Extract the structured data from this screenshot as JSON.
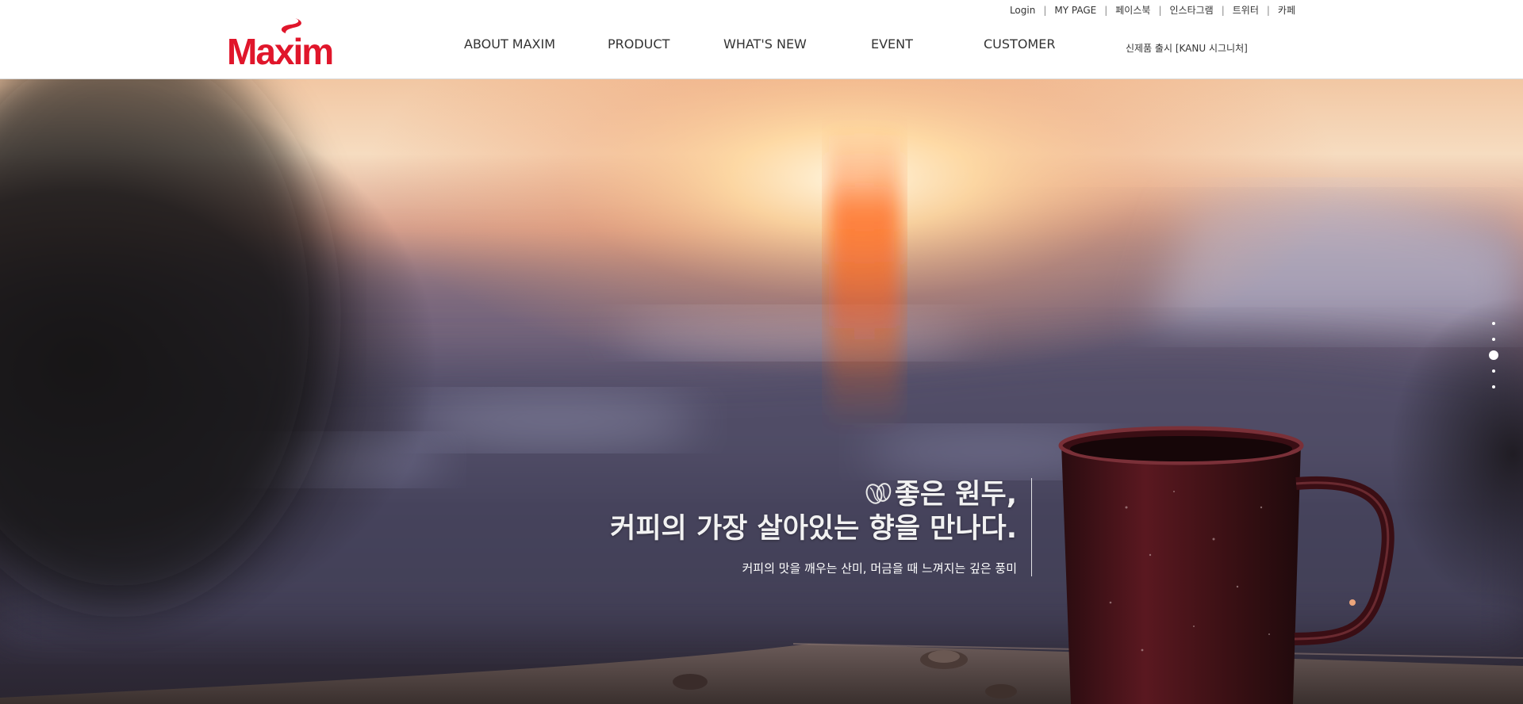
{
  "brand": {
    "logo_text": "Maxim",
    "logo_color": "#e0162b"
  },
  "util_links": [
    "Login",
    "MY PAGE",
    "페이스북",
    "인스타그램",
    "트위터",
    "카페"
  ],
  "util_separator": "|",
  "nav": {
    "items": [
      "ABOUT MAXIM",
      "PRODUCT",
      "WHAT'S NEW",
      "EVENT",
      "CUSTOMER"
    ],
    "notice": "신제품 출시 [KANU 시그니처]"
  },
  "hero": {
    "headline_1": "좋은 원두,",
    "headline_2": "커피의 가장 살아있는 향을 만나다.",
    "subtext": "커피의 맛을 깨우는 산미, 머금을 때 느껴지는 깊은 풍미",
    "icons": {
      "bean": "coffee-bean-icon"
    }
  },
  "slider": {
    "total": 5,
    "active_index": 2
  }
}
